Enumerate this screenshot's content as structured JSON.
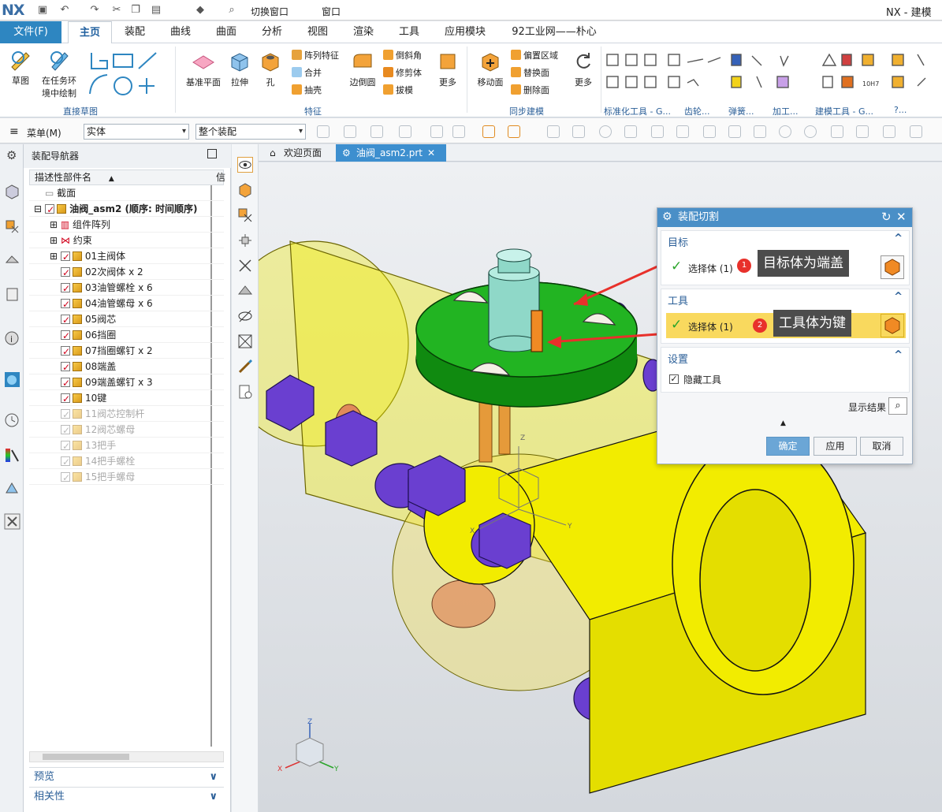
{
  "app": {
    "logo": "NX",
    "title": "NX - 建模"
  },
  "qat": {
    "switch_window": "切换窗口",
    "window": "窗口"
  },
  "tabs": [
    {
      "label": "文件(F)"
    },
    {
      "label": "主页"
    },
    {
      "label": "装配"
    },
    {
      "label": "曲线"
    },
    {
      "label": "曲面"
    },
    {
      "label": "分析"
    },
    {
      "label": "视图"
    },
    {
      "label": "渲染"
    },
    {
      "label": "工具"
    },
    {
      "label": "应用模块"
    },
    {
      "label": "92工业网——朴心"
    }
  ],
  "ribbon": {
    "sketch": "草图",
    "sketch_env": "在任务环",
    "sketch_env2": "境中绘制",
    "direct_sketch": "直接草图",
    "datum": "基准平面",
    "extrude": "拉伸",
    "hole": "孔",
    "pattern": "阵列特征",
    "unite": "合并",
    "shell": "抽壳",
    "edge_blend": "边倒圆",
    "chamfer": "倒斜角",
    "trim": "修剪体",
    "draft": "拔模",
    "more": "更多",
    "feature": "特征",
    "move_face": "移动面",
    "offset_region": "偏置区域",
    "replace_face": "替换面",
    "delete_face": "删除面",
    "more2": "更多",
    "sync": "同步建模",
    "std_tools": "标准化工具 - G...",
    "gear": "齿轮...",
    "spring": "弹簧...",
    "machining": "加工...",
    "build_tools": "建模工具 - G...",
    "more3": "?..."
  },
  "selbar": {
    "menu": "菜单(M)",
    "filter": "实体",
    "scope": "整个装配"
  },
  "navigator": {
    "title": "装配导航器",
    "col1": "描述性部件名",
    "col2": "信",
    "rows": [
      {
        "label": "截面",
        "state": "none"
      },
      {
        "label": "油阀_asm2 (顺序: 时间顺序)",
        "state": "on"
      },
      {
        "label": "组件阵列",
        "state": "none"
      },
      {
        "label": "约束",
        "state": "none"
      },
      {
        "label": "01主阀体",
        "state": "on"
      },
      {
        "label": "02次阀体 x 2",
        "state": "on"
      },
      {
        "label": "03油管螺栓 x 6",
        "state": "on"
      },
      {
        "label": "04油管螺母 x 6",
        "state": "on"
      },
      {
        "label": "05阀芯",
        "state": "on"
      },
      {
        "label": "06挡圈",
        "state": "on"
      },
      {
        "label": "07挡圈螺钉 x 2",
        "state": "on"
      },
      {
        "label": "08端盖",
        "state": "on"
      },
      {
        "label": "09端盖螺钉 x 3",
        "state": "on"
      },
      {
        "label": "10键",
        "state": "on"
      },
      {
        "label": "11阀芯控制杆",
        "state": "gray"
      },
      {
        "label": "12阀芯螺母",
        "state": "gray"
      },
      {
        "label": "13把手",
        "state": "gray"
      },
      {
        "label": "14把手螺栓",
        "state": "gray"
      },
      {
        "label": "15把手螺母",
        "state": "gray"
      }
    ],
    "preview": "预览",
    "dependency": "相关性"
  },
  "doctabs": {
    "welcome": "欢迎页面",
    "part": "油阀_asm2.prt"
  },
  "dialog": {
    "title": "装配切割",
    "target_section": "目标",
    "target_select": "选择体 (1)",
    "target_badge": "1",
    "target_callout": "目标体为端盖",
    "tool_section": "工具",
    "tool_select": "选择体 (1)",
    "tool_badge": "2",
    "tool_callout": "工具体为键",
    "settings_section": "设置",
    "hide_tool": "隐藏工具",
    "show_result": "显示结果",
    "ok": "确定",
    "apply": "应用",
    "cancel": "取消"
  },
  "triad": {
    "z": "Z",
    "x": "X",
    "y": "Y"
  },
  "colors": {
    "accent": "#2e86c1",
    "yellow": "#f2ec00",
    "green": "#22b422",
    "purple": "#6a3fd0",
    "orange": "#f08a24"
  }
}
